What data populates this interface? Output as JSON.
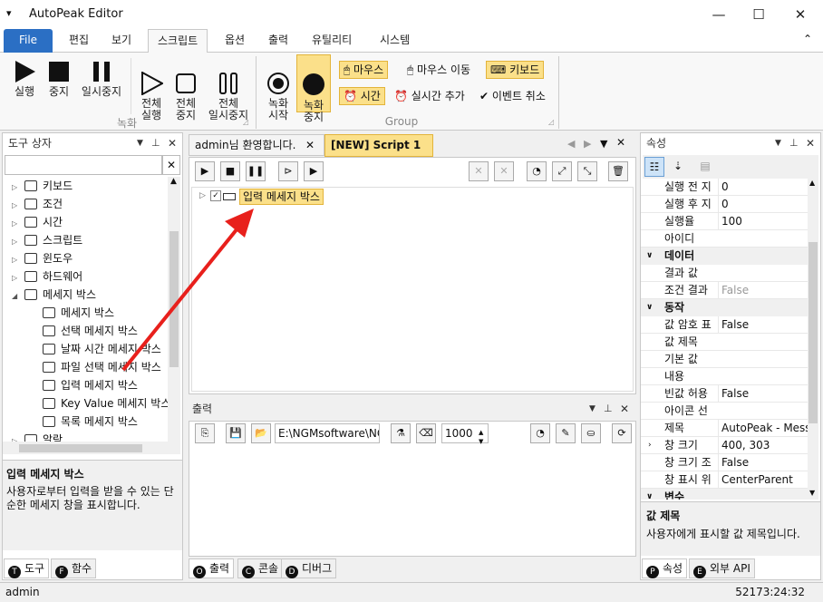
{
  "app": {
    "title": "AutoPeak Editor",
    "menu_glyph": "▾"
  },
  "window_controls": {
    "minimize": "—",
    "maximize": "☐",
    "close": "✕"
  },
  "ribbon_tabs": [
    "File",
    "편집",
    "보기",
    "스크립트",
    "옵션",
    "출력",
    "유틸리티",
    "시스템"
  ],
  "ribbon": {
    "collapse_glyph": "⌃",
    "record_group_label": "녹화",
    "group_label": "Group",
    "buttons": [
      {
        "label": "실행"
      },
      {
        "label": "중지"
      },
      {
        "label": "일시중지"
      },
      {
        "label": "전체\n실행"
      },
      {
        "label": "전체\n중지"
      },
      {
        "label": "전체\n일시중지"
      },
      {
        "label": "녹화\n시작"
      },
      {
        "label": "녹화\n중지"
      }
    ],
    "chips": [
      {
        "label": "마우스",
        "active": true
      },
      {
        "label": "마우스 이동",
        "active": false
      },
      {
        "label": "키보드",
        "active": true
      },
      {
        "label": "시간",
        "active": true
      },
      {
        "label": "실시간 추가",
        "active": false
      },
      {
        "label": "이벤트 취소",
        "active": false
      }
    ]
  },
  "toolbox": {
    "title": "도구 상자",
    "items": [
      {
        "label": "키보드",
        "level": 0,
        "exp": "▷"
      },
      {
        "label": "조건",
        "level": 0,
        "exp": "▷"
      },
      {
        "label": "시간",
        "level": 0,
        "exp": "▷"
      },
      {
        "label": "스크립트",
        "level": 0,
        "exp": "▷"
      },
      {
        "label": "윈도우",
        "level": 0,
        "exp": "▷"
      },
      {
        "label": "하드웨어",
        "level": 0,
        "exp": "▷"
      },
      {
        "label": "메세지 박스",
        "level": 0,
        "exp": "◢"
      },
      {
        "label": "메세지 박스",
        "level": 1,
        "exp": ""
      },
      {
        "label": "선택 메세지 박스",
        "level": 1,
        "exp": ""
      },
      {
        "label": "날짜 시간 메세지 박스",
        "level": 1,
        "exp": ""
      },
      {
        "label": "파일 선택 메세지 박스",
        "level": 1,
        "exp": ""
      },
      {
        "label": "입력 메세지 박스",
        "level": 1,
        "exp": ""
      },
      {
        "label": "Key Value 메세지 박스",
        "level": 1,
        "exp": ""
      },
      {
        "label": "목록 메세지 박스",
        "level": 1,
        "exp": ""
      },
      {
        "label": "알람",
        "level": 0,
        "exp": "▷"
      }
    ],
    "desc_title": "입력 메세지 박스",
    "desc_text": "사용자로부터 입력을 받을 수 있는 단순한 메세지 창을 표시합니다.",
    "bottom_tabs": [
      {
        "key": "T",
        "label": "도구"
      },
      {
        "key": "F",
        "label": "함수"
      }
    ]
  },
  "editor": {
    "tabs": [
      {
        "label": "admin님 환영합니다.",
        "active": false
      },
      {
        "label": "[NEW] Script 1",
        "active": true
      }
    ],
    "node_label": "입력 메세지 박스"
  },
  "output": {
    "title": "출력",
    "path": "E:\\NGMsoftware\\NG",
    "count": "1000",
    "bottom_tabs": [
      {
        "key": "O",
        "label": "출력"
      },
      {
        "key": "C",
        "label": "콘솔"
      },
      {
        "key": "D",
        "label": "디버그"
      }
    ]
  },
  "properties": {
    "title": "속성",
    "rows": [
      {
        "type": "row",
        "k": "실행 전 지",
        "v": "0"
      },
      {
        "type": "row",
        "k": "실행 후 지",
        "v": "0"
      },
      {
        "type": "row",
        "k": "실행율",
        "v": "100"
      },
      {
        "type": "row",
        "k": "아이디",
        "v": ""
      },
      {
        "type": "cat",
        "k": "데이터"
      },
      {
        "type": "row",
        "k": "결과 값",
        "v": ""
      },
      {
        "type": "row",
        "k": "조건 결과",
        "v": "False",
        "grey": true
      },
      {
        "type": "cat",
        "k": "동작"
      },
      {
        "type": "row",
        "k": "값 암호 표",
        "v": "False"
      },
      {
        "type": "row",
        "k": "값 제목",
        "v": ""
      },
      {
        "type": "row",
        "k": "기본 값",
        "v": ""
      },
      {
        "type": "row",
        "k": "내용",
        "v": ""
      },
      {
        "type": "row",
        "k": "빈값 허용",
        "v": "False"
      },
      {
        "type": "row",
        "k": "아이콘 선",
        "v": ""
      },
      {
        "type": "row",
        "k": "제목",
        "v": "AutoPeak - Messa"
      },
      {
        "type": "row",
        "k": "창 크기",
        "v": "400, 303",
        "exp": true
      },
      {
        "type": "row",
        "k": "창 크기 조",
        "v": "False"
      },
      {
        "type": "row",
        "k": "창 표시 위",
        "v": "CenterParent"
      },
      {
        "type": "cat",
        "k": "변수"
      }
    ],
    "desc_title": "값 제목",
    "desc_text": "사용자에게 표시할 값 제목입니다.",
    "bottom_tabs": [
      {
        "key": "P",
        "label": "속성"
      },
      {
        "key": "E",
        "label": "외부 API"
      }
    ]
  },
  "statusbar": {
    "user": "admin",
    "time": "52173:24:32"
  },
  "colors": {
    "accent": "#2b6fc4",
    "highlight": "#fbe08a",
    "arrow": "#e8201c"
  }
}
